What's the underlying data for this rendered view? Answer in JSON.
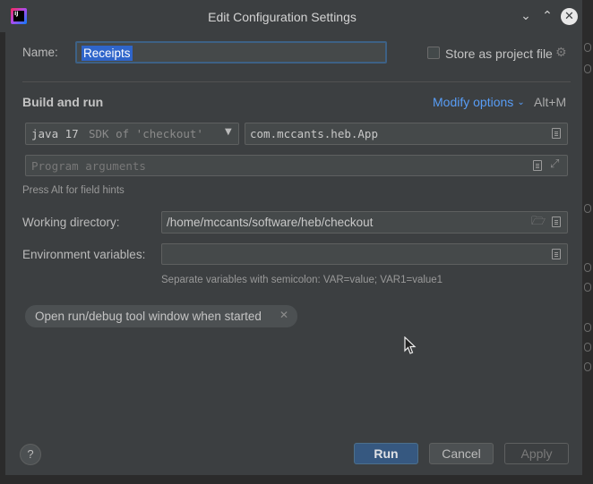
{
  "window": {
    "title": "Edit Configuration Settings",
    "minimize_glyph": "⌄",
    "maximize_glyph": "⌃",
    "close_glyph": "✕",
    "app_icon_text": "IJ"
  },
  "name_row": {
    "label": "Name:",
    "value": "Receipts",
    "store_label": "Store as project file"
  },
  "build_run": {
    "heading": "Build and run",
    "modify_options": "Modify options",
    "modify_shortcut": "Alt+M",
    "sdk_java": "java 17",
    "sdk_detail": "SDK of 'checkout'",
    "main_class": "com.mccants.heb.App",
    "program_args_placeholder": "Program arguments",
    "field_hint": "Press Alt for field hints"
  },
  "working_dir": {
    "label": "Working directory:",
    "value": "/home/mccants/software/heb/checkout"
  },
  "env_vars": {
    "label": "Environment variables:",
    "value": "",
    "hint": "Separate variables with semicolon: VAR=value; VAR1=value1"
  },
  "chip": {
    "label": "Open run/debug tool window when started"
  },
  "footer": {
    "help_label": "?",
    "run_label": "Run",
    "cancel_label": "Cancel",
    "apply_label": "Apply"
  },
  "colors": {
    "accent_link": "#589df6",
    "primary_button": "#365880",
    "selection": "#2f65ca"
  }
}
